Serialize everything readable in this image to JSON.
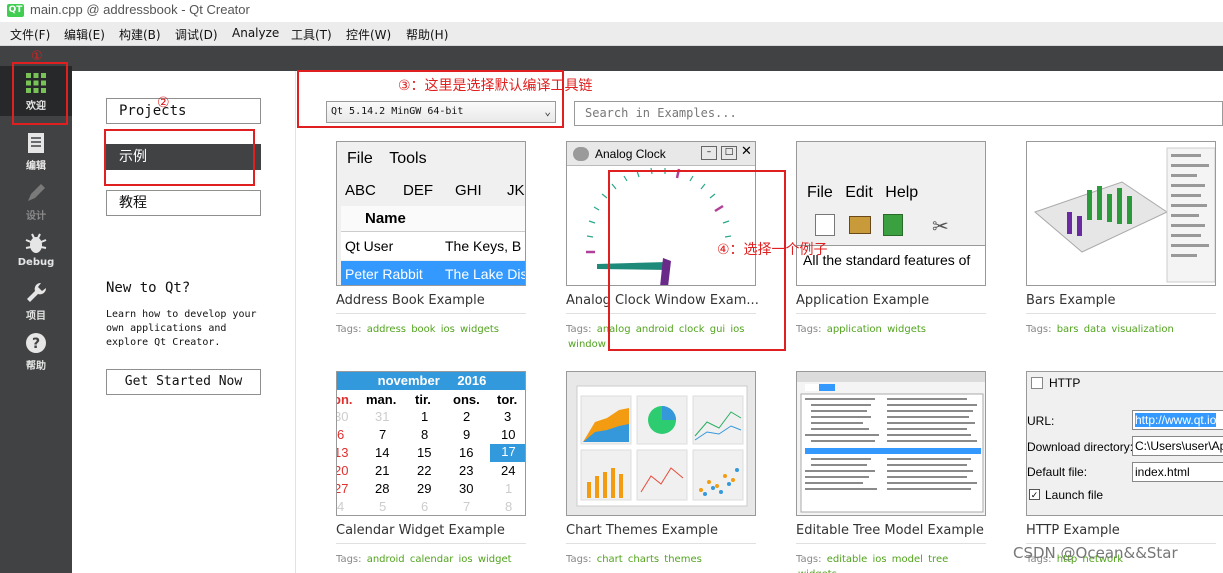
{
  "window": {
    "title": "main.cpp @ addressbook - Qt Creator",
    "logo_text": "QT"
  },
  "menubar": [
    "文件(F)",
    "编辑(E)",
    "构建(B)",
    "调试(D)",
    "Analyze",
    "工具(T)",
    "控件(W)",
    "帮助(H)"
  ],
  "modebar": [
    {
      "label": "欢迎",
      "icon": "welcome-grid-icon"
    },
    {
      "label": "编辑",
      "icon": "edit-document-icon"
    },
    {
      "label": "设计",
      "icon": "design-pen-icon"
    },
    {
      "label": "Debug",
      "icon": "debug-bug-icon"
    },
    {
      "label": "项目",
      "icon": "projects-wrench-icon"
    },
    {
      "label": "帮助",
      "icon": "help-question-icon"
    }
  ],
  "left_panel": {
    "projects": "Projects",
    "examples": "示例",
    "tutorials": "教程",
    "new_to_qt": "New to Qt?",
    "learn_text": "Learn how to develop your own applications and explore Qt Creator.",
    "get_started": "Get Started Now"
  },
  "kit_select": {
    "value": "Qt 5.14.2 MinGW 64-bit"
  },
  "search": {
    "placeholder": "Search in Examples..."
  },
  "examples": [
    {
      "title": "Address Book Example",
      "tags": [
        "address",
        "book",
        "ios",
        "widgets"
      ]
    },
    {
      "title": "Analog Clock Window Exam...",
      "tags": [
        "analog",
        "android",
        "clock",
        "gui",
        "ios",
        "window"
      ]
    },
    {
      "title": "Application Example",
      "tags": [
        "application",
        "widgets"
      ]
    },
    {
      "title": "Bars Example",
      "tags": [
        "bars",
        "data",
        "visualization"
      ]
    },
    {
      "title": "Calendar Widget Example",
      "tags": [
        "android",
        "calendar",
        "ios",
        "widget"
      ]
    },
    {
      "title": "Chart Themes Example",
      "tags": [
        "chart",
        "charts",
        "themes"
      ]
    },
    {
      "title": "Editable Tree Model Example",
      "tags": [
        "editable",
        "ios",
        "model",
        "tree",
        "widgets"
      ]
    },
    {
      "title": "HTTP Example",
      "tags": [
        "http",
        "network"
      ]
    }
  ],
  "tags_label": "Tags:",
  "thumbs": {
    "addressbook": {
      "menu": [
        "File",
        "Tools"
      ],
      "tabs": [
        "ABC",
        "DEF",
        "GHI",
        "JKL"
      ],
      "header": "Name",
      "rows": [
        [
          "Qt User",
          "The Keys, B"
        ],
        [
          "Peter Rabbit",
          "The Lake Dis"
        ]
      ]
    },
    "analogclock": {
      "title": "Analog Clock"
    },
    "application": {
      "menu": [
        "File",
        "Edit",
        "Help"
      ],
      "text": "All the standard features of"
    },
    "calendar": {
      "month": "november",
      "year": "2016",
      "days": [
        "on.",
        "man.",
        "tir.",
        "ons.",
        "tor."
      ],
      "weeks": [
        [
          "30",
          "31",
          "1",
          "2",
          "3"
        ],
        [
          "6",
          "7",
          "8",
          "9",
          "10"
        ],
        [
          "13",
          "14",
          "15",
          "16",
          "17"
        ],
        [
          "20",
          "21",
          "22",
          "23",
          "24"
        ],
        [
          "27",
          "28",
          "29",
          "30",
          "1"
        ],
        [
          "4",
          "5",
          "6",
          "7",
          "8"
        ]
      ]
    },
    "http": {
      "title": "HTTP",
      "url_label": "URL:",
      "url_value": "http://www.qt.io",
      "dir_label": "Download directory:",
      "dir_value": "C:\\Users\\user\\Ap",
      "file_label": "Default file:",
      "file_value": "index.html",
      "launch": "Launch file"
    }
  },
  "annotations": {
    "one": "①",
    "two": "②",
    "three": "③：这里是选择默认编译工具链",
    "four": "④：选择一个例子"
  },
  "watermark": "CSDN @Ocean&&Star",
  "colors": {
    "sidebar": "#404244",
    "active": "#262829",
    "tag": "#52a41e",
    "annotation": "#e02020",
    "welcome_green": "#78c257"
  }
}
